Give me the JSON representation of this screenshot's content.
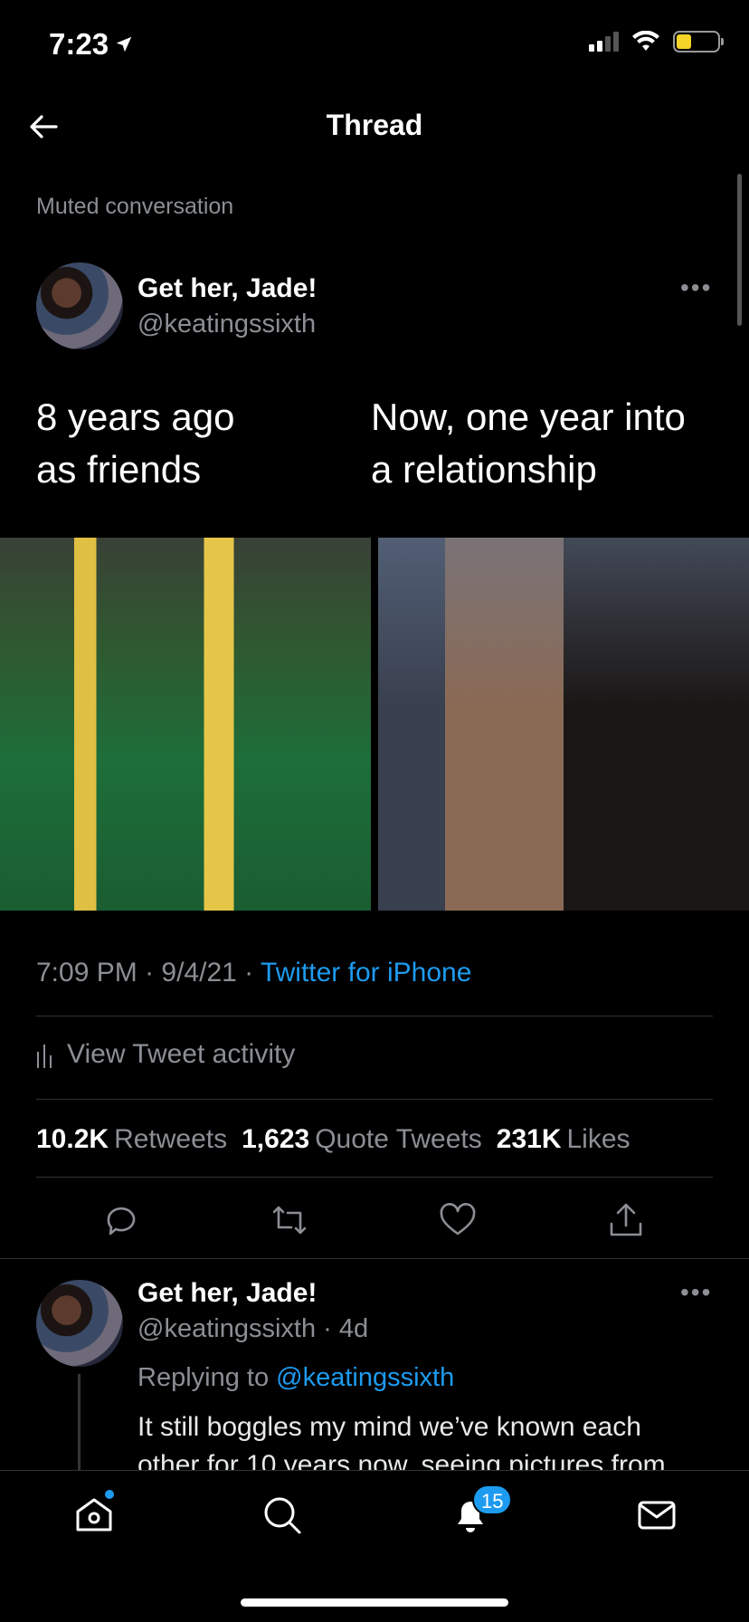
{
  "status_bar": {
    "time": "7:23"
  },
  "header": {
    "title": "Thread"
  },
  "thread": {
    "muted_label": "Muted conversation"
  },
  "main_tweet": {
    "author_name": "Get her, Jade!",
    "author_handle": "@keatingssixth",
    "text_left_line1": "8 years ago",
    "text_left_line2": "as friends",
    "text_right_line1": "Now, one year into",
    "text_right_line2": "a relationship",
    "time": "7:09 PM",
    "date": "9/4/21",
    "source": "Twitter for iPhone",
    "activity_label": "View Tweet activity",
    "retweets_count": "10.2K",
    "retweets_label": "Retweets",
    "quotes_count": "1,623",
    "quotes_label": "Quote Tweets",
    "likes_count": "231K",
    "likes_label": "Likes"
  },
  "reply": {
    "author_name": "Get her, Jade!",
    "author_handle": "@keatingssixth",
    "age": "4d",
    "replying_prefix": "Replying to",
    "replying_to": "@keatingssixth",
    "text_line1": "It still boggles my mind we’ve known each",
    "text_line2": "other for 10 years now, seeing pictures from"
  },
  "tab_bar": {
    "notifications_badge": "15"
  },
  "colors": {
    "accent": "#1d9bf0",
    "background": "#000000",
    "secondary_text": "#8b8f94"
  }
}
